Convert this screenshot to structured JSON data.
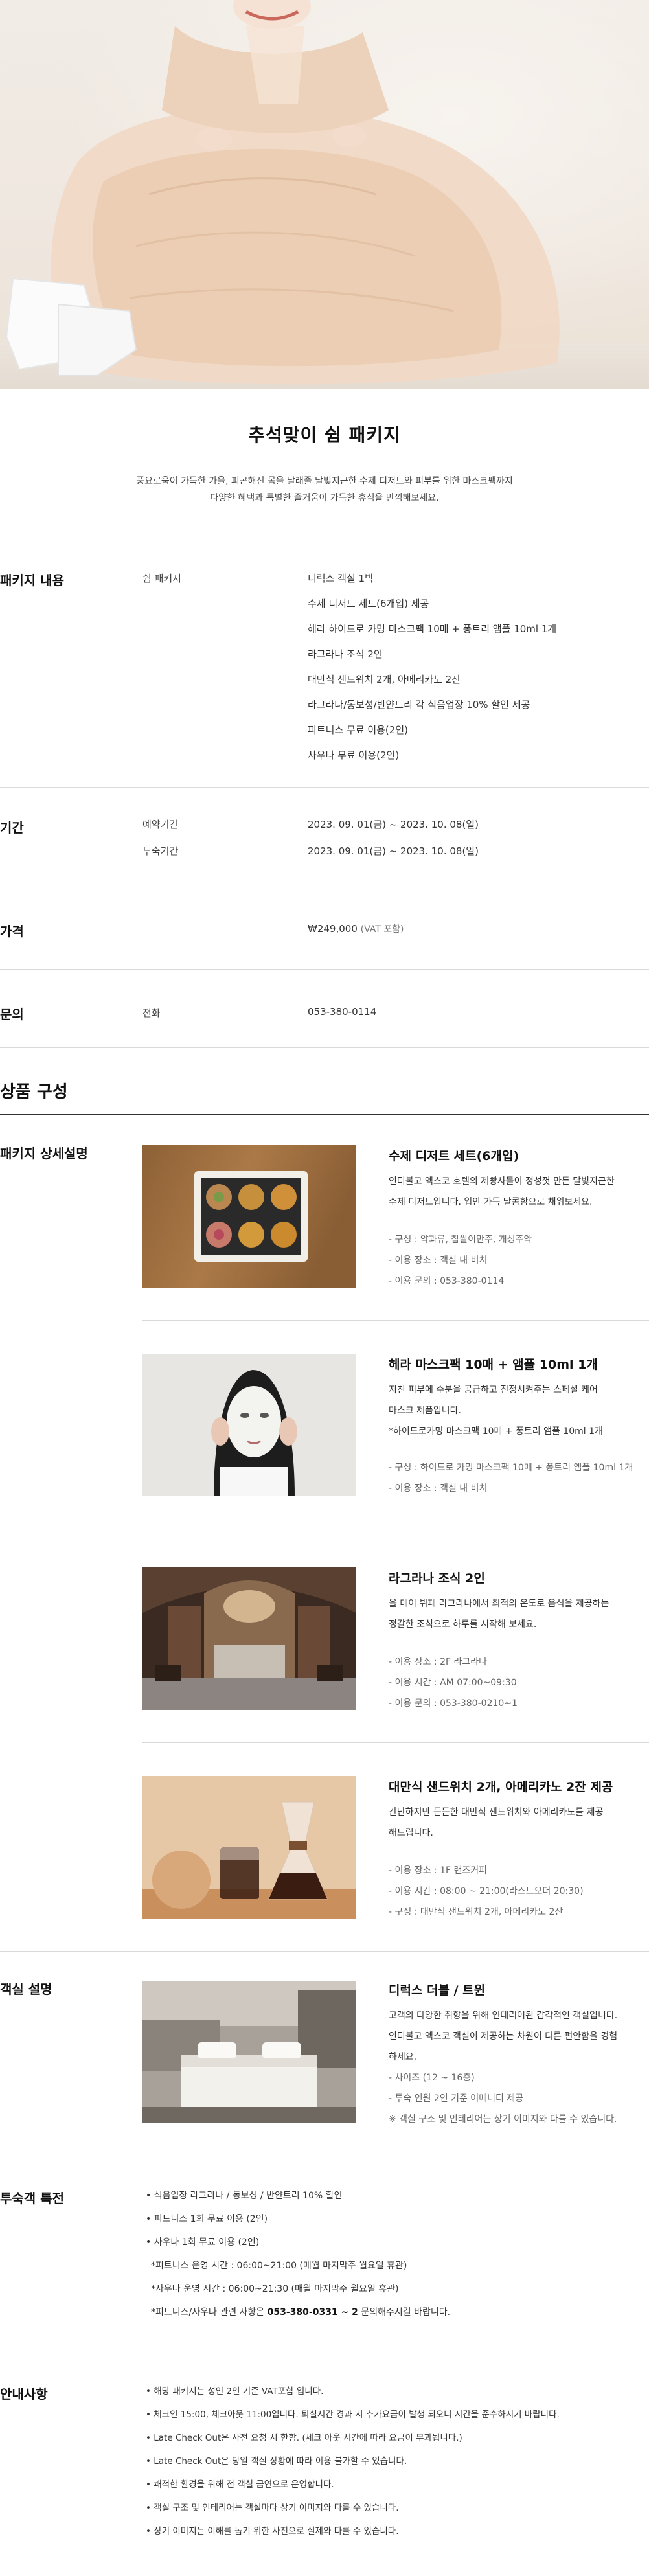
{
  "hero": {
    "alt": "hanbok-model-photo"
  },
  "title": "추석맞이 쉼 패키지",
  "description": [
    "풍요로움이 가득한 가을, 피곤해진 몸을 달래줄 달빛지근한 수제 디저트와 피부를 위한 마스크팩까지",
    "다양한 혜택과 특별한 즐거움이 가득한 휴식을 만끽해보세요."
  ],
  "package": {
    "label": "패키지 내용",
    "sub_label": "쉼 패키지",
    "items": [
      "디럭스 객실 1박",
      "수제 디저트 세트(6개입) 제공",
      "헤라 하이드로 카밍 마스크팩 10매 + 퐁트리 앰플 10ml 1개",
      "라그라나 조식 2인",
      "대만식 샌드위치 2개, 아메리카노 2잔",
      "라그라나/동보성/반얀트리 각 식음업장 10% 할인 제공",
      "피트니스 무료 이용(2인)",
      "사우나 무료 이용(2인)"
    ]
  },
  "period": {
    "label": "기간",
    "rows": [
      {
        "label": "예약기간",
        "value": "2023. 09. 01(금) ~ 2023. 10. 08(일)"
      },
      {
        "label": "투숙기간",
        "value": "2023. 09. 01(금) ~ 2023. 10. 08(일)"
      }
    ]
  },
  "price": {
    "label": "가격",
    "value": "₩249,000",
    "vat": "(VAT 포함)"
  },
  "inquiry": {
    "label": "문의",
    "sub_label": "전화",
    "value": "053-380-0114"
  },
  "composition_title": "상품 구성",
  "package_detail": {
    "label": "패키지 상세설명",
    "products": [
      {
        "title": "수제 디저트 세트(6개입)",
        "desc": [
          "인터불고 엑스코 호텔의 제빵사들이 정성껏 만든 달빛지근한",
          "수제 디저트입니다. 입안 가득 달콤함으로 채워보세요."
        ],
        "details": [
          "- 구성 : 약과류, 찹쌀이만주, 개성주악",
          "- 이용 장소 : 객실 내 비치",
          "- 이용 문의 : 053-380-0114"
        ]
      },
      {
        "title": "헤라 마스크팩 10매 + 앰플 10ml 1개",
        "desc": [
          "지친 피부에 수분을 공급하고 진정시켜주는 스페셜 케어",
          "마스크 제품입니다.",
          "*하이드로카밍 마스크팩 10매 + 퐁트리 앰플 10ml 1개"
        ],
        "details": [
          "- 구성 : 하이드로 카밍 마스크팩 10매 + 퐁트리 앰플 10ml 1개",
          "- 이용 장소 : 객실 내 비치"
        ]
      },
      {
        "title": "라그라나 조식 2인",
        "desc": [
          "올 데이 뷔페 라그라나에서 최적의 온도로 음식을 제공하는",
          "정갈한 조식으로 하루를 시작해 보세요."
        ],
        "details": [
          "- 이용 장소 : 2F 라그라나",
          "- 이용 시간 : AM 07:00~09:30",
          "- 이용 문의 : 053-380-0210~1"
        ]
      },
      {
        "title": "대만식 샌드위치 2개, 아메리카노 2잔 제공",
        "desc": [
          "간단하지만 든든한 대만식 샌드위치와 아메리카노를 제공",
          "해드립니다."
        ],
        "details": [
          "- 이용 장소 : 1F 랜즈커피",
          "- 이용 시간 : 08:00 ~ 21:00(라스트오더 20:30)",
          "- 구성 : 대만식 샌드위치 2개, 아메리카노 2잔"
        ]
      }
    ]
  },
  "room": {
    "label": "객실 설명",
    "title": "디럭스 더블 / 트윈",
    "desc": [
      "고객의 다양한 취향을 위해 인테리어된 감각적인 객실입니다.",
      "인터불고 엑스코 객실이 제공하는 차원이 다른 편안함을 경험",
      "하세요."
    ],
    "details": [
      "- 사이즈 (12 ~ 16층)",
      "- 투숙 인원 2인 기준 어메니티 제공",
      "※ 객실 구조 및 인테리어는 상기 이미지와 다를 수 있습니다."
    ]
  },
  "benefits": {
    "label": "투숙객 특전",
    "items": [
      "• 식음업장 라그라나 / 동보성 / 반얀트리 10% 할인",
      "• 피트니스 1회 무료 이용 (2인)",
      "• 사우나 1회 무료 이용 (2인)",
      "*피트니스 운영 시간 : 06:00~21:00 (매월 마지막주 월요일 휴관)",
      "*사우나 운영 시간 : 06:00~21:30 (매월 마지막주 월요일 휴관)"
    ],
    "contact_prefix": "*피트니스/사우나 관련 사항은 ",
    "contact_number": "053-380-0331 ~ 2",
    "contact_suffix": " 문의해주시길 바랍니다."
  },
  "notice": {
    "label": "안내사항",
    "items": [
      "• 해당 패키지는 성인 2인 기준 VAT포함 입니다.",
      "• 체크인 15:00, 체크아웃 11:00입니다. 퇴실시간 경과 시 추가요금이 발생 되오니 시간을 준수하시기 바랍니다.",
      "• Late Check Out은 사전 요청 시 한함. (체크 아웃 시간에 따라 요금이 부과됩니다.)",
      "• Late Check Out은 당일 객실 상황에 따라 이용 불가할 수 있습니다.",
      "• 쾌적한 환경을 위해 전 객실 금연으로 운영합니다.",
      "• 객실 구조 및 인테리어는 객실마다 상기 이미지와 다를 수 있습니다.",
      "• 상기 이미지는 이해를 돕기 위한 사진으로 실제와 다를 수 있습니다."
    ]
  }
}
